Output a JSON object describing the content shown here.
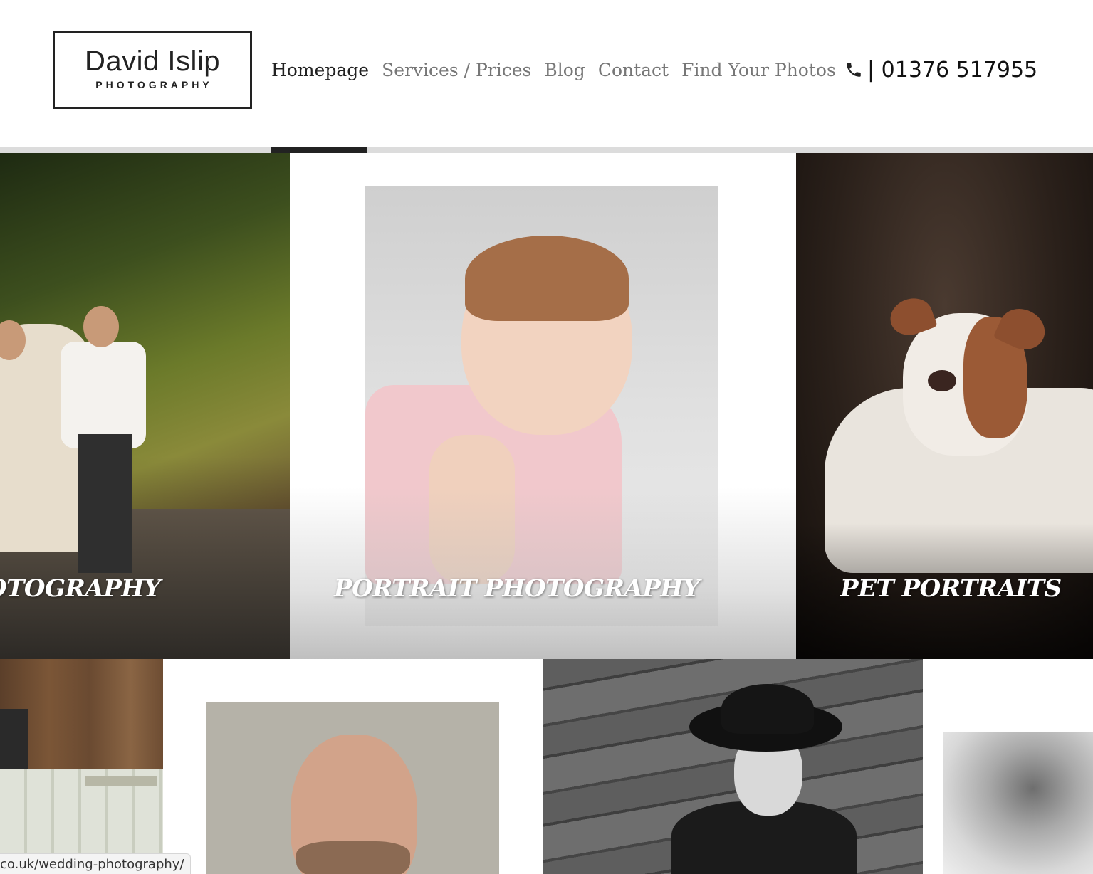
{
  "logo": {
    "name": "David Islip",
    "subtitle": "PHOTOGRAPHY"
  },
  "nav": {
    "items": [
      {
        "label": "Homepage",
        "active": true
      },
      {
        "label": "Services / Prices",
        "active": false
      },
      {
        "label": "Blog",
        "active": false
      },
      {
        "label": "Contact",
        "active": false
      },
      {
        "label": "Find Your Photos",
        "active": false
      }
    ]
  },
  "phone": {
    "icon": "phone-icon",
    "text": "| 01376 517955"
  },
  "tiles": {
    "wedding": {
      "caption": "OTOGRAPHY"
    },
    "portrait": {
      "caption": "PORTRAIT PHOTOGRAPHY"
    },
    "pet": {
      "caption": "PET PORTRAITS"
    }
  },
  "status_bar": {
    "url": "co.uk/wedding-photography/"
  },
  "colors": {
    "text_dark": "#222222",
    "nav_muted": "#777777",
    "nav_bar": "#dcdcdc",
    "nav_active_bar": "#222222"
  }
}
